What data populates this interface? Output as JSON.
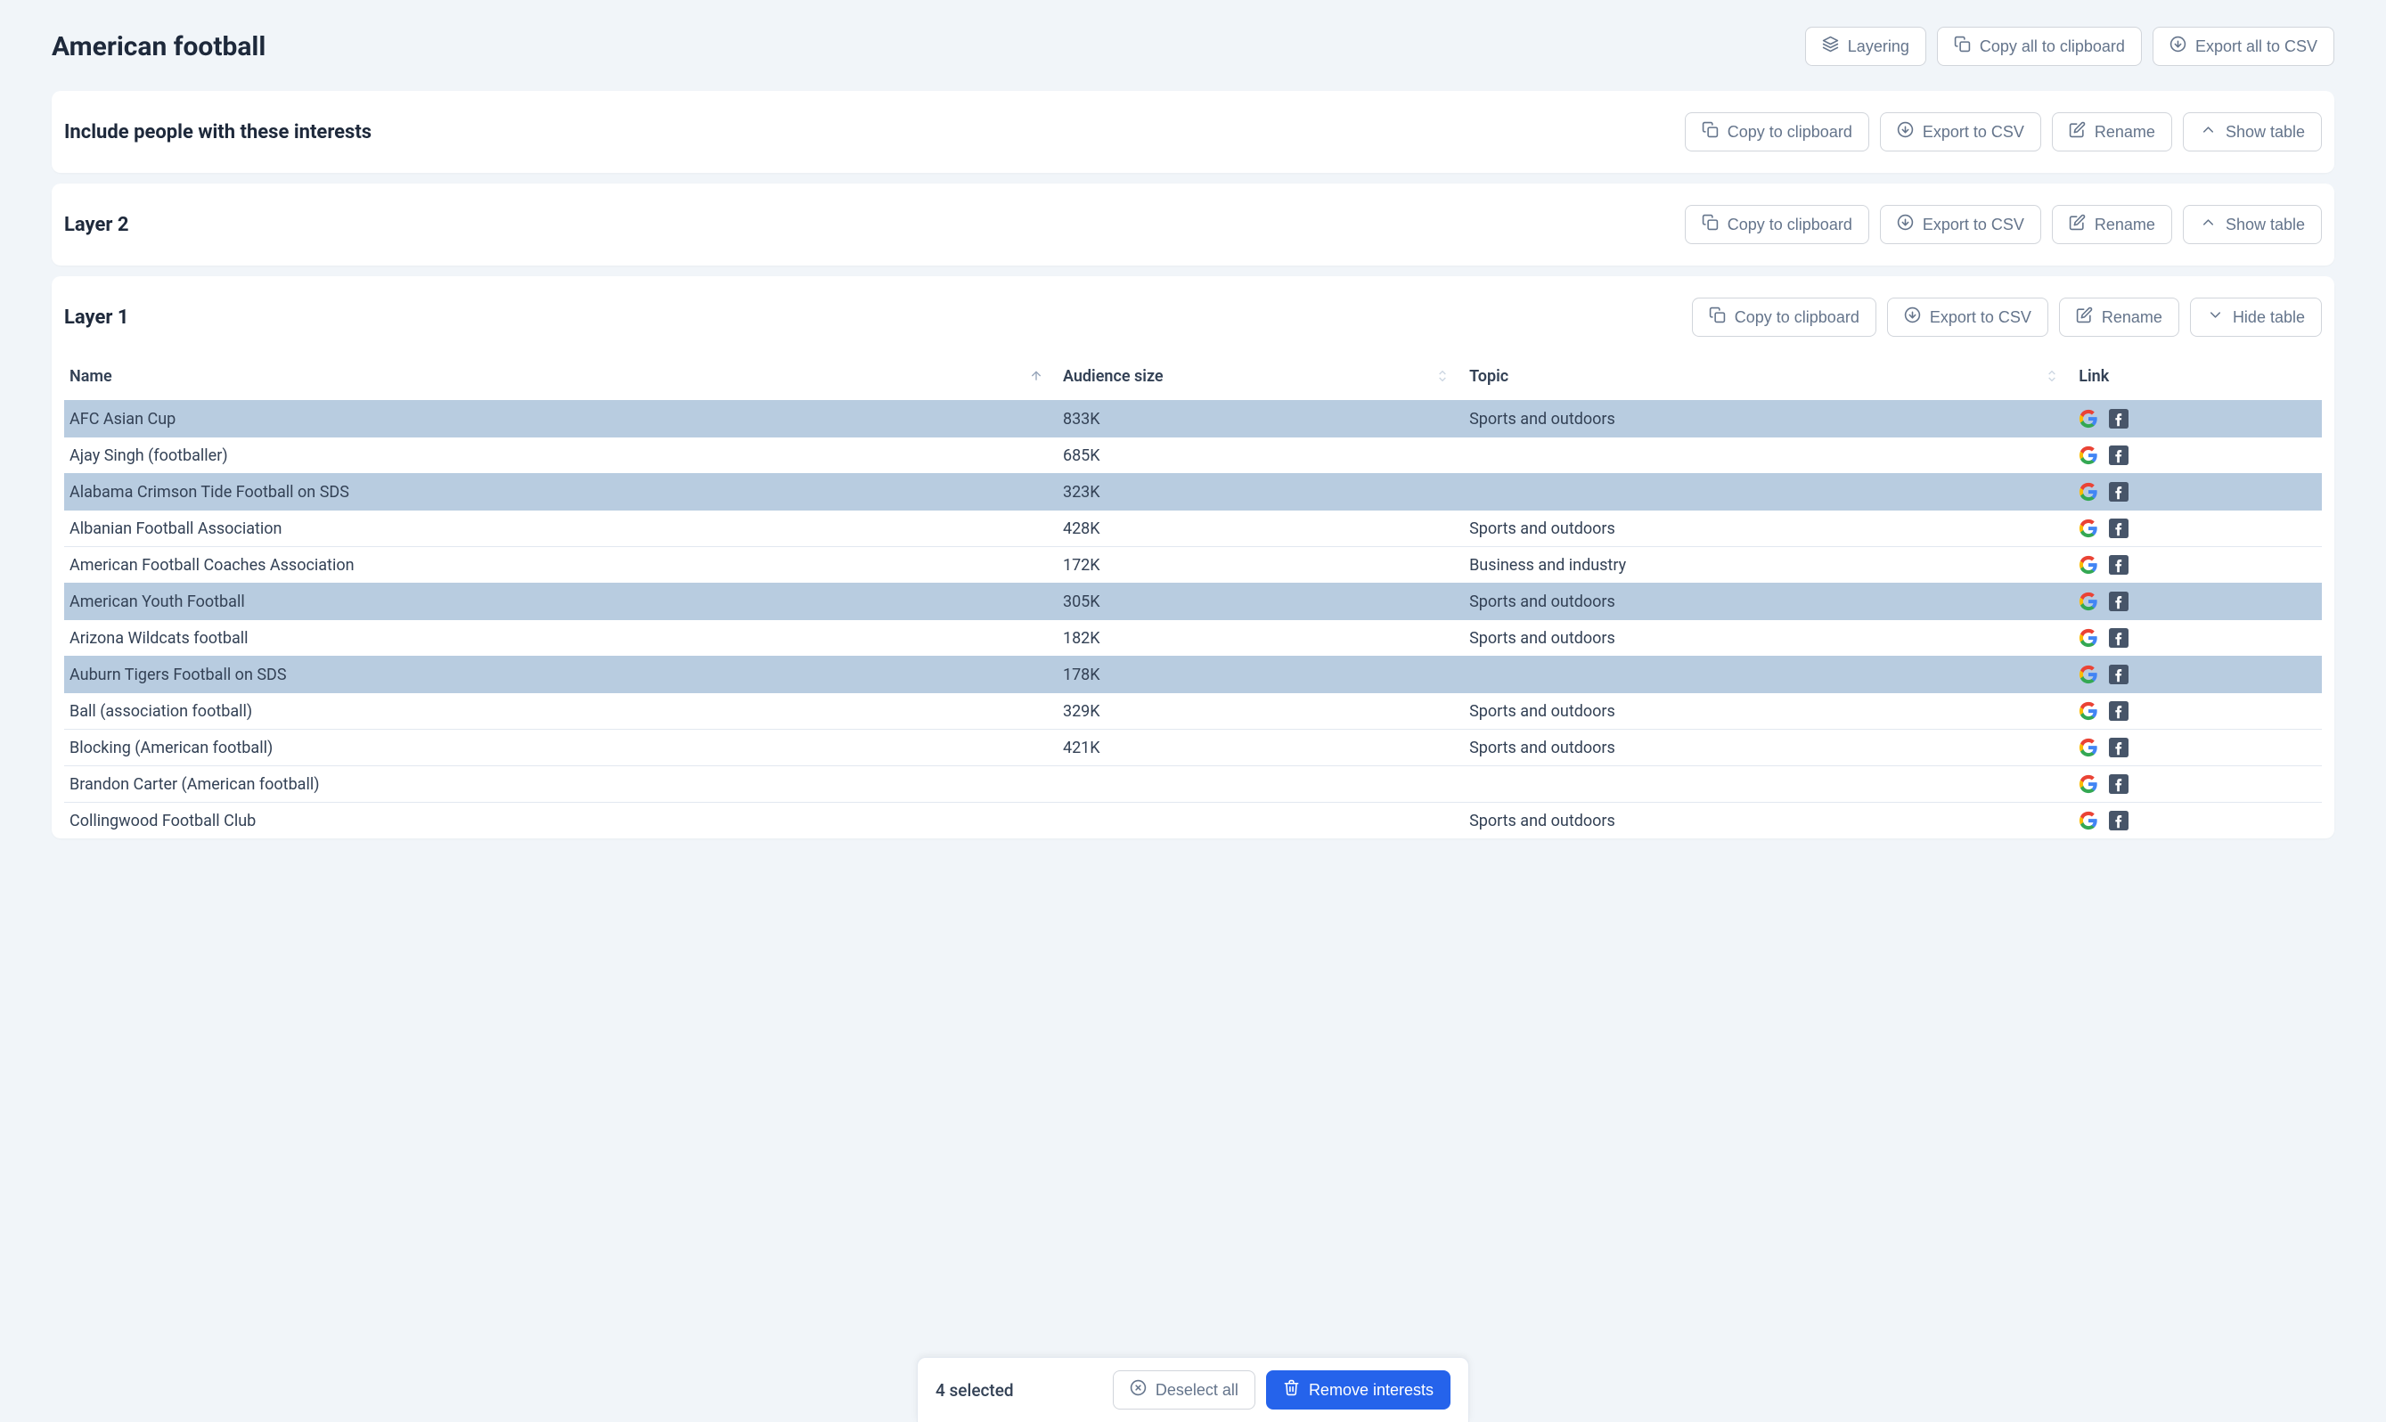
{
  "page": {
    "title": "American football"
  },
  "toolbar": {
    "layering": "Layering",
    "copy_all": "Copy all to clipboard",
    "export_all": "Export all to CSV"
  },
  "panels": [
    {
      "title": "Include people with these interests",
      "actions": {
        "copy": "Copy to clipboard",
        "export": "Export to CSV",
        "rename": "Rename",
        "toggle": "Show table"
      },
      "collapsed": true
    },
    {
      "title": "Layer 2",
      "actions": {
        "copy": "Copy to clipboard",
        "export": "Export to CSV",
        "rename": "Rename",
        "toggle": "Show table"
      },
      "collapsed": true
    },
    {
      "title": "Layer 1",
      "actions": {
        "copy": "Copy to clipboard",
        "export": "Export to CSV",
        "rename": "Rename",
        "toggle": "Hide table"
      },
      "collapsed": false,
      "columns": {
        "name": "Name",
        "audience": "Audience size",
        "topic": "Topic",
        "link": "Link"
      },
      "rows": [
        {
          "name": "AFC Asian Cup",
          "audience": "833K",
          "topic": "Sports and outdoors",
          "selected": true
        },
        {
          "name": "Ajay Singh (footballer)",
          "audience": "685K",
          "topic": "",
          "selected": false
        },
        {
          "name": "Alabama Crimson Tide Football on SDS",
          "audience": "323K",
          "topic": "",
          "selected": true
        },
        {
          "name": "Albanian Football Association",
          "audience": "428K",
          "topic": "Sports and outdoors",
          "selected": false
        },
        {
          "name": "American Football Coaches Association",
          "audience": "172K",
          "topic": "Business and industry",
          "selected": false
        },
        {
          "name": "American Youth Football",
          "audience": "305K",
          "topic": "Sports and outdoors",
          "selected": true
        },
        {
          "name": "Arizona Wildcats football",
          "audience": "182K",
          "topic": "Sports and outdoors",
          "selected": false
        },
        {
          "name": "Auburn Tigers Football on SDS",
          "audience": "178K",
          "topic": "",
          "selected": true
        },
        {
          "name": "Ball (association football)",
          "audience": "329K",
          "topic": "Sports and outdoors",
          "selected": false
        },
        {
          "name": "Blocking (American football)",
          "audience": "421K",
          "topic": "Sports and outdoors",
          "selected": false
        },
        {
          "name": "Brandon Carter (American football)",
          "audience": "",
          "topic": "",
          "selected": false
        },
        {
          "name": "Collingwood Football Club",
          "audience": "",
          "topic": "Sports and outdoors",
          "selected": false
        }
      ]
    }
  ],
  "selection_bar": {
    "count_label": "4 selected",
    "deselect": "Deselect all",
    "remove": "Remove interests"
  }
}
